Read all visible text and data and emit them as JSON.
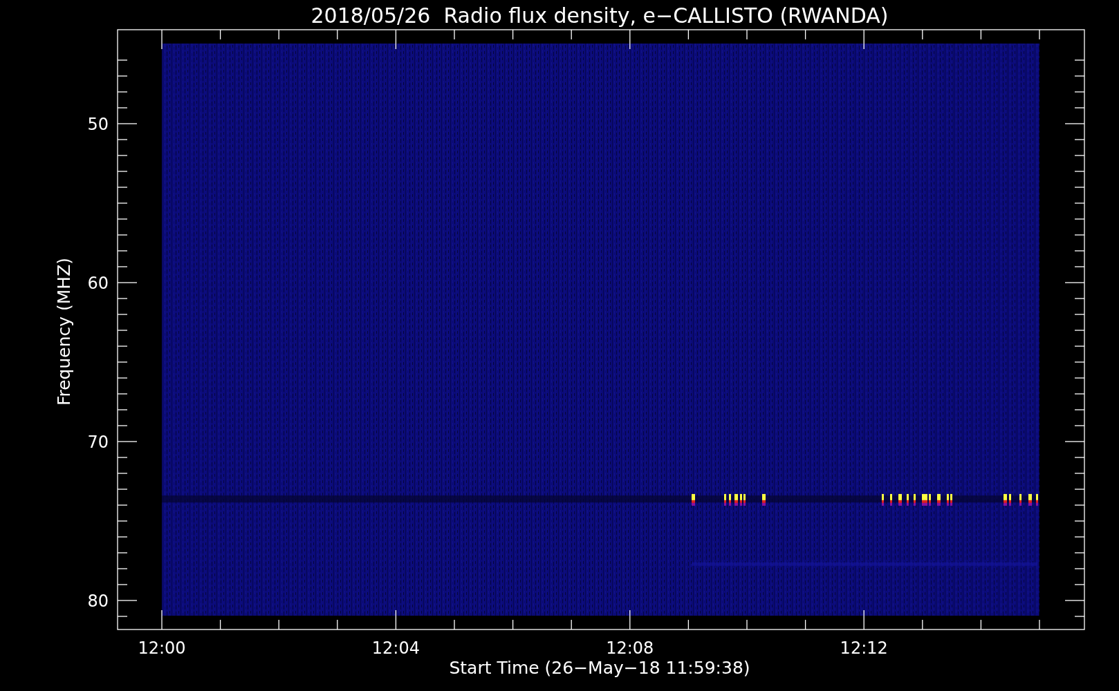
{
  "title": "2018/05/26  Radio flux density, e−CALLISTO (RWANDA)",
  "y_axis": {
    "label": "Frequency (MHZ)",
    "ticks": [
      "50",
      "60",
      "70",
      "80"
    ]
  },
  "x_axis": {
    "label": "Start Time (26−May−18 11:59:38)",
    "ticks": [
      "12:00",
      "12:04",
      "12:08",
      "12:12"
    ]
  }
}
